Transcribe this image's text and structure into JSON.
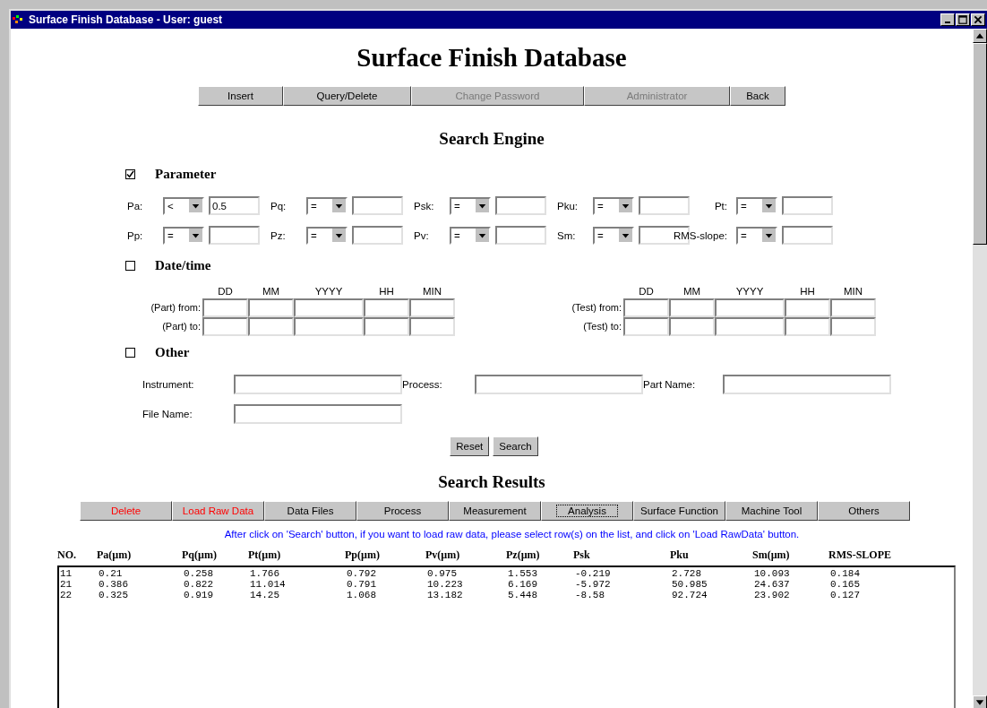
{
  "window": {
    "title": "Surface Finish Database - User: guest"
  },
  "heading": "Surface Finish Database",
  "nav_buttons": [
    {
      "label": "Insert",
      "disabled": false
    },
    {
      "label": "Query/Delete",
      "disabled": false
    },
    {
      "label": "Change Password",
      "disabled": true
    },
    {
      "label": "Administrator",
      "disabled": true
    },
    {
      "label": "Back",
      "disabled": false
    }
  ],
  "search_engine": {
    "title": "Search Engine",
    "parameter": {
      "label": "Parameter",
      "checked": true,
      "rows": [
        [
          {
            "label": "Pa:",
            "operator": "<",
            "value": "0.5"
          },
          {
            "label": "Pq:",
            "operator": "="
          },
          {
            "label": "Psk:",
            "operator": "="
          },
          {
            "label": "Pku:",
            "operator": "="
          },
          {
            "label": "Pt:",
            "operator": "="
          }
        ],
        [
          {
            "label": "Pp:",
            "operator": "="
          },
          {
            "label": "Pz:",
            "operator": "="
          },
          {
            "label": "Pv:",
            "operator": "="
          },
          {
            "label": "Sm:",
            "operator": "="
          },
          {
            "label": "RMS-slope:",
            "operator": "="
          }
        ]
      ]
    },
    "datetime": {
      "label": "Date/time",
      "checked": false,
      "groups": [
        {
          "rows": [
            "(Part) from:",
            "(Part) to:"
          ],
          "columns": [
            "DD",
            "MM",
            "YYYY",
            "HH",
            "MIN"
          ]
        },
        {
          "rows": [
            "(Test) from:",
            "(Test) to:"
          ],
          "columns": [
            "DD",
            "MM",
            "YYYY",
            "HH",
            "MIN"
          ]
        }
      ]
    },
    "other": {
      "label": "Other",
      "checked": false,
      "fields": [
        "Instrument:",
        "Process:",
        "Part Name:",
        "File Name:"
      ]
    },
    "buttons": [
      "Reset",
      "Search"
    ]
  },
  "search_results": {
    "title": "Search Results",
    "tabs": [
      {
        "label": "Delete",
        "kind": "warning",
        "focused": false
      },
      {
        "label": "Load Raw Data",
        "kind": "warning",
        "focused": false
      },
      {
        "label": "Data Files",
        "kind": "normal",
        "focused": false
      },
      {
        "label": "Process",
        "kind": "normal",
        "focused": false
      },
      {
        "label": "Measurement",
        "kind": "normal",
        "focused": false
      },
      {
        "label": "Analysis",
        "kind": "normal",
        "focused": true
      },
      {
        "label": "Surface Function",
        "kind": "normal",
        "focused": false
      },
      {
        "label": "Machine Tool",
        "kind": "normal",
        "focused": false
      },
      {
        "label": "Others",
        "kind": "normal",
        "focused": false
      }
    ],
    "note": "After click on 'Search' button, if you want to load raw data, please select row(s) on the list, and click on 'Load RawData' button.",
    "table": {
      "columns": [
        "NO.",
        "Pa(µm)",
        "Pq(µm)",
        "Pt(µm)",
        "Pp(µm)",
        "Pv(µm)",
        "Pz(µm)",
        "Psk",
        "Pku",
        "Sm(µm)",
        "RMS-SLOPE"
      ],
      "rows": [
        [
          "11",
          "0.21",
          "0.258",
          "1.766",
          "0.792",
          "0.975",
          "1.553",
          "-0.219",
          "2.728",
          "10.093",
          "0.184"
        ],
        [
          "21",
          "0.386",
          "0.822",
          "11.014",
          "0.791",
          "10.223",
          "6.169",
          "-5.972",
          "50.985",
          "24.637",
          "0.165"
        ],
        [
          "22",
          "0.325",
          "0.919",
          "14.25",
          "1.068",
          "13.182",
          "5.448",
          "-8.58",
          "92.724",
          "23.902",
          "0.127"
        ]
      ]
    }
  }
}
